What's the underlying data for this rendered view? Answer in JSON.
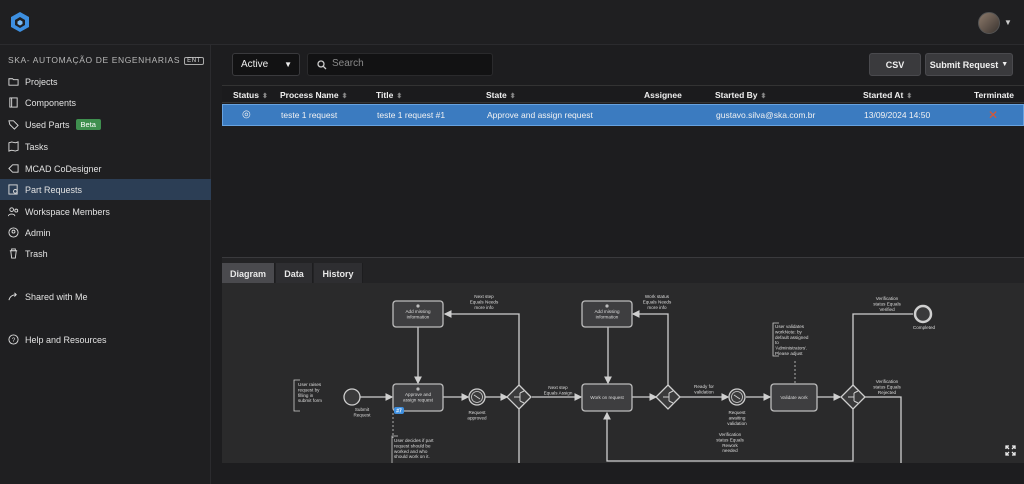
{
  "org": {
    "name": "SKA- AUTOMAÇÃO DE ENGENHARIAS",
    "badge": "ENT"
  },
  "sidebar": {
    "items": [
      {
        "label": "Projects",
        "icon": "folder-icon"
      },
      {
        "label": "Components",
        "icon": "components-icon"
      },
      {
        "label": "Used Parts",
        "icon": "tag-icon",
        "badge": "Beta"
      },
      {
        "label": "Tasks",
        "icon": "tasks-icon"
      },
      {
        "label": "MCAD CoDesigner",
        "icon": "codesigner-icon"
      },
      {
        "label": "Part Requests",
        "icon": "part-requests-icon",
        "active": true
      },
      {
        "label": "Workspace Members",
        "icon": "members-icon"
      },
      {
        "label": "Admin",
        "icon": "admin-icon"
      },
      {
        "label": "Trash",
        "icon": "trash-icon"
      }
    ],
    "shared": "Shared with Me",
    "help": "Help and Resources"
  },
  "toolbar": {
    "filter_value": "Active",
    "search_placeholder": "Search",
    "csv_label": "CSV",
    "submit_label": "Submit Request"
  },
  "table": {
    "headers": [
      "Status",
      "Process Name",
      "Title",
      "State",
      "Assignee",
      "Started By",
      "Started At",
      "Terminate"
    ],
    "rows": [
      {
        "status": "◎",
        "process_name": "teste 1 request",
        "title": "teste 1 request #1",
        "state": "Approve and assign request",
        "assignee": "",
        "started_by": "gustavo.silva@ska.com.br",
        "started_at": "13/09/2024 14:50",
        "terminate": "✕"
      }
    ]
  },
  "tabs": [
    "Diagram",
    "Data",
    "History"
  ],
  "diagram": {
    "annotation_submit": "User raises\nrequest by\nfilling in\nsubmit form",
    "start_label": "Submit\nRequest",
    "task_add_info_1": "Add missing\ninformation",
    "task_approve": "Approve and\nassign request",
    "badge_count": "#7",
    "event_request_approved": "Request\napproved",
    "next_step_info": "Next step\nEquals Needs\nmore info",
    "next_step_assign": "Next step\nEquals Assign",
    "annotation_user_decides": "User decides if part\nrequest should be\nworked and who\nshould work on it.",
    "task_add_info_2": "Add missing\ninformation",
    "work_status_info": "Work status\nEquals Needs\nmore info",
    "task_work": "Work on request",
    "ready_for_validation": "Ready for\nvalidation",
    "event_awaiting_validation": "Request\nawaiting\nvalidation",
    "task_validate": "Validate work",
    "annotation_validates": "User validates\nworkNote: by\ndefault assigned\nto\n'Administrators'.\nPlease adjust",
    "verification_verified": "Verification\nstatus Equals\nVerified",
    "end_label": "Completed",
    "verification_rejected": "Verification\nstatus Equals\nRejected",
    "verification_rework": "Verification\nstatus Equals\nRework\nneeded"
  },
  "colors": {
    "accent": "#3b7bc0",
    "beta": "#3f8f4f",
    "terminate": "#e0552f"
  }
}
